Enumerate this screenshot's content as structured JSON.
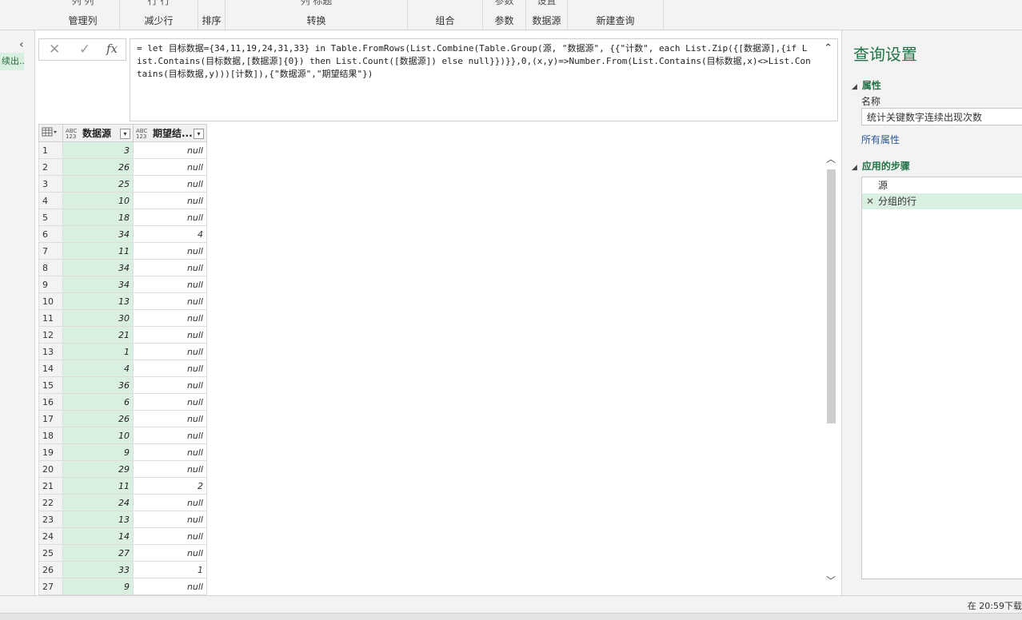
{
  "ribbon": {
    "groups": [
      {
        "label": "管理列",
        "cut": "列    列"
      },
      {
        "label": "减少行",
        "cut": "行    行"
      },
      {
        "label": "排序",
        "cut": ""
      },
      {
        "label": "转换",
        "cut": "列    标题"
      },
      {
        "label": "组合",
        "cut": ""
      },
      {
        "label": "参数",
        "cut": "参数"
      },
      {
        "label": "数据源",
        "cut": "设置"
      },
      {
        "label": "新建查询",
        "cut": ""
      }
    ]
  },
  "left_pane": {
    "collapse_icon": "‹",
    "query_item": "续出..."
  },
  "formula_bar": {
    "cancel_icon": "✕",
    "confirm_icon": "✓",
    "fx_label": "fx",
    "text": "= let 目标数据={34,11,19,24,31,33} in Table.FromRows(List.Combine(Table.Group(源, \"数据源\", {{\"计数\", each List.Zip({[数据源],{if List.Contains(目标数据,[数据源]{0}) then List.Count([数据源]) else null}})}},0,(x,y)=>Number.From(List.Contains(目标数据,x)<>List.Contains(目标数据,y)))[计数]),{\"数据源\",\"期望结果\"})",
    "expand_icon": "⌃"
  },
  "grid": {
    "type_badge": "ABC\n123",
    "columns": [
      "数据源",
      "期望结..."
    ],
    "rows": [
      [
        "1",
        "3",
        "null"
      ],
      [
        "2",
        "26",
        "null"
      ],
      [
        "3",
        "25",
        "null"
      ],
      [
        "4",
        "10",
        "null"
      ],
      [
        "5",
        "18",
        "null"
      ],
      [
        "6",
        "34",
        "4"
      ],
      [
        "7",
        "11",
        "null"
      ],
      [
        "8",
        "34",
        "null"
      ],
      [
        "9",
        "34",
        "null"
      ],
      [
        "10",
        "13",
        "null"
      ],
      [
        "11",
        "30",
        "null"
      ],
      [
        "12",
        "21",
        "null"
      ],
      [
        "13",
        "1",
        "null"
      ],
      [
        "14",
        "4",
        "null"
      ],
      [
        "15",
        "36",
        "null"
      ],
      [
        "16",
        "6",
        "null"
      ],
      [
        "17",
        "26",
        "null"
      ],
      [
        "18",
        "10",
        "null"
      ],
      [
        "19",
        "9",
        "null"
      ],
      [
        "20",
        "29",
        "null"
      ],
      [
        "21",
        "11",
        "2"
      ],
      [
        "22",
        "24",
        "null"
      ],
      [
        "23",
        "13",
        "null"
      ],
      [
        "24",
        "14",
        "null"
      ],
      [
        "25",
        "27",
        "null"
      ],
      [
        "26",
        "33",
        "1"
      ],
      [
        "27",
        "9",
        "null"
      ]
    ]
  },
  "query_settings": {
    "title": "查询设置",
    "properties_header": "属性",
    "name_label": "名称",
    "name_value": "统计关键数字连续出现次数",
    "all_properties": "所有属性",
    "steps_header": "应用的步骤",
    "steps": [
      "源",
      "分组的行"
    ]
  },
  "status_bar": {
    "text": "在 20:59下载"
  }
}
